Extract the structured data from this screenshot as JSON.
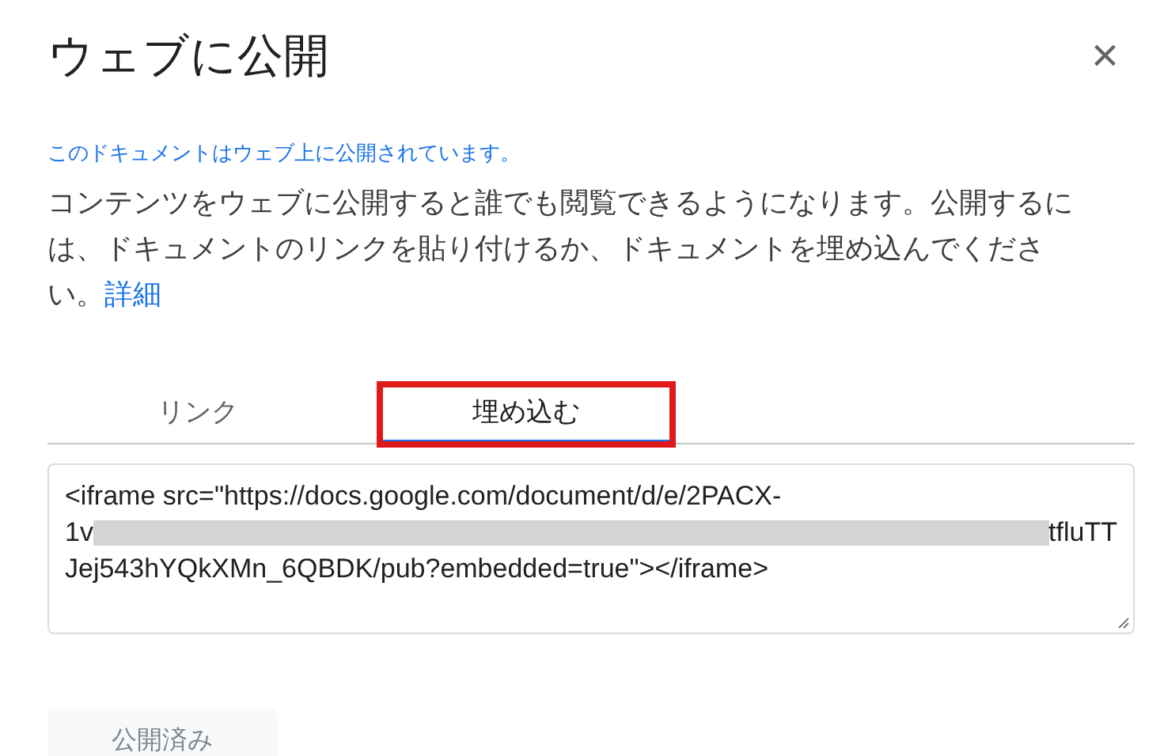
{
  "dialog": {
    "title": "ウェブに公開",
    "close": "×"
  },
  "notice": "このドキュメントはウェブ上に公開されています。",
  "description": {
    "text": "コンテンツをウェブに公開すると誰でも閲覧できるようになります。公開するには、ドキュメントのリンクを貼り付けるか、ドキュメントを埋め込んでください。",
    "link": "詳細"
  },
  "tabs": [
    {
      "label": "リンク",
      "selected": false,
      "highlighted": false
    },
    {
      "label": "埋め込む",
      "selected": true,
      "highlighted": true
    }
  ],
  "embed_code": {
    "lines": [
      {
        "text": "<iframe src=\"https://docs.google.com/document/d/e/2PACX-",
        "redacted": false
      },
      {
        "text": "1v",
        "redacted": true,
        "tail": "tfluTT"
      },
      {
        "text": "Jej543hYQkXMn_6QBDK/pub?embedded=true\"></iframe>",
        "redacted": false
      }
    ]
  },
  "publish_button": {
    "label": "公開済み",
    "disabled": true
  }
}
